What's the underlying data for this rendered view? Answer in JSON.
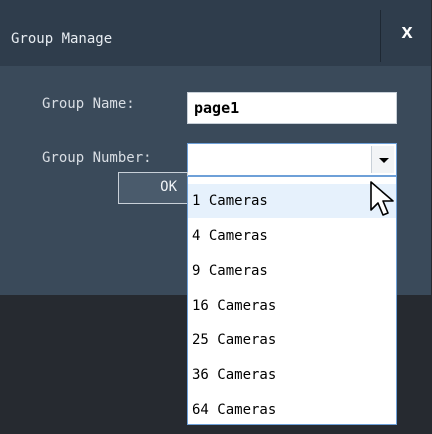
{
  "dialog": {
    "title": "Group Manage",
    "close_label": "x",
    "group_name_label": "Group Name:",
    "group_name_value": "page1",
    "group_number_label": "Group Number:",
    "ok_label": "OK"
  },
  "dropdown": {
    "options": [
      "1 Cameras",
      "4 Cameras",
      "9 Cameras",
      "16 Cameras",
      "25 Cameras",
      "36 Cameras",
      "64 Cameras"
    ],
    "highlighted": "1 Cameras"
  },
  "colors": {
    "dialog_bg": "#3a4a5a",
    "titlebar_bg": "#2f3d4c",
    "highlight": "#e6f1fc",
    "border_focus": "#6ea0d8"
  }
}
